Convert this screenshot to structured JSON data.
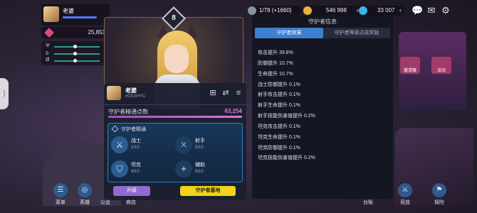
{
  "profile": {
    "name": "老婆"
  },
  "power": {
    "value": "25,853"
  },
  "stats": [
    {
      "symbol": "Ψ",
      "level": 0.45
    },
    {
      "symbol": "ẟ",
      "level": 0.45
    },
    {
      "symbol": "Ø",
      "level": 0.45
    }
  ],
  "resources": [
    {
      "label": "1/78 (+1660)",
      "plus": "+",
      "color": "#8a93a6"
    },
    {
      "label": "546 998",
      "plus": "+",
      "color": "#e7b43a"
    },
    {
      "label": "33 007",
      "plus": "+",
      "color": "#3ab6e7"
    }
  ],
  "top_icons": [
    "chat-icon",
    "mail-icon",
    "settings-icon"
  ],
  "top_icon_glyphs": [
    "💬",
    "✉",
    "⚙"
  ],
  "hero": {
    "level": "8"
  },
  "guardian_panel": {
    "name": "老婆",
    "id": "#CEAHYC",
    "points_label": "守护者精通点数",
    "points_value": "63,254",
    "points_fill": 1.0,
    "mastery_title": "守护者精通",
    "classes": [
      {
        "name": "战士",
        "count": "1/10",
        "icon": "⚔",
        "active": true
      },
      {
        "name": "射手",
        "count": "3/10",
        "icon": "✕",
        "active": false
      },
      {
        "name": "坦克",
        "count": "4/10",
        "icon": "⛉",
        "active": true
      },
      {
        "name": "辅助",
        "count": "0/10",
        "icon": "✦",
        "active": false
      }
    ],
    "upgrade_label": "升级",
    "base_label": "守护者基地"
  },
  "info_panel": {
    "title": "守护者信息",
    "tabs": [
      "守护者效果",
      "守护者等级达成奖励"
    ],
    "effects": [
      "攻击提升 39.8%",
      "防御提升 10.7%",
      "生命提升 10.7%",
      "战士防御提升 0.1%",
      "射手攻击提升 0.1%",
      "射手生命提升 0.1%",
      "射手技能伤害值提升 0.2%",
      "坦克攻击提升 0.1%",
      "坦克生命提升 0.1%",
      "坦克防御提升 0.1%",
      "坦克技能伤害值提升 0.2%"
    ]
  },
  "bottom_nav": [
    {
      "label": "菜单",
      "glyph": "☰"
    },
    {
      "label": "英雄",
      "glyph": "◎"
    },
    {
      "label": "公会",
      "glyph": ""
    },
    {
      "label": "商店",
      "glyph": ""
    }
  ],
  "bottom_right": [
    "台账",
    "竞技",
    "探险"
  ],
  "right_buttons": [
    "邀请赛",
    "活动"
  ]
}
